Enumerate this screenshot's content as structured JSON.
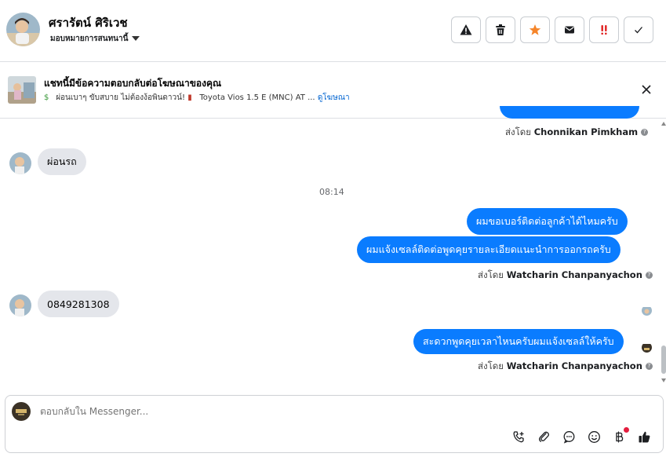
{
  "header": {
    "contact_name": "ศรารัตน์ ศิริเวช",
    "assign_label": "มอบหมายการสนทนานี้",
    "actions": [
      {
        "name": "report-spam-button",
        "icon": "warning-icon"
      },
      {
        "name": "delete-button",
        "icon": "trash-icon"
      },
      {
        "name": "star-button",
        "icon": "star-icon"
      },
      {
        "name": "mark-unread-button",
        "icon": "envelope-icon"
      },
      {
        "name": "follow-up-button",
        "icon": "double-exclamation-icon"
      },
      {
        "name": "mark-done-button",
        "icon": "check-icon"
      }
    ]
  },
  "ad_banner": {
    "title": "แชทนี้มีข้อความตอบกลับต่อโฆษณาของคุณ",
    "subtitle_part1": "ผ่อนเบาๆ ขับสบาย ไม่ต้องง้อพินดาวน์!",
    "subtitle_part2": "Toyota Vios 1.5 E (MNC) AT ...",
    "link": "ดูโฆษณา"
  },
  "messages": {
    "sent_by_top": {
      "prefix": "ส่งโดย",
      "name": "Chonnikan Pimkham"
    },
    "incoming_1": "ผ่อนรถ",
    "timestamp": "08:14",
    "outgoing_1": "ผมขอเบอร์ติดต่อลูกค้าได้ไหมครับ",
    "outgoing_2": "ผมแจ้งเซลล์ติดต่อพูดคุยรายละเอียดแนะนำการออกรถครับ",
    "sent_by_2": {
      "prefix": "ส่งโดย",
      "name": "Watcharin Chanpanyachon"
    },
    "incoming_2": "0849281308",
    "outgoing_3": "สะดวกพูดคุยเวลาไหนครับผมแจ้งเซลล์ให้ครับ",
    "sent_by_3": {
      "prefix": "ส่งโดย",
      "name": "Watcharin Chanpanyachon"
    }
  },
  "composer": {
    "placeholder": "ตอบกลับใน Messenger...",
    "tools": [
      "call-add-icon",
      "paperclip-icon",
      "chat-bubble-icon",
      "emoji-icon",
      "baht-icon",
      "thumbs-up-icon"
    ]
  },
  "colors": {
    "outgoing_bubble": "#0a7cff",
    "incoming_bubble": "#e4e6eb",
    "link": "#0064d1",
    "star": "#f5852a",
    "flag": "#e02020"
  }
}
